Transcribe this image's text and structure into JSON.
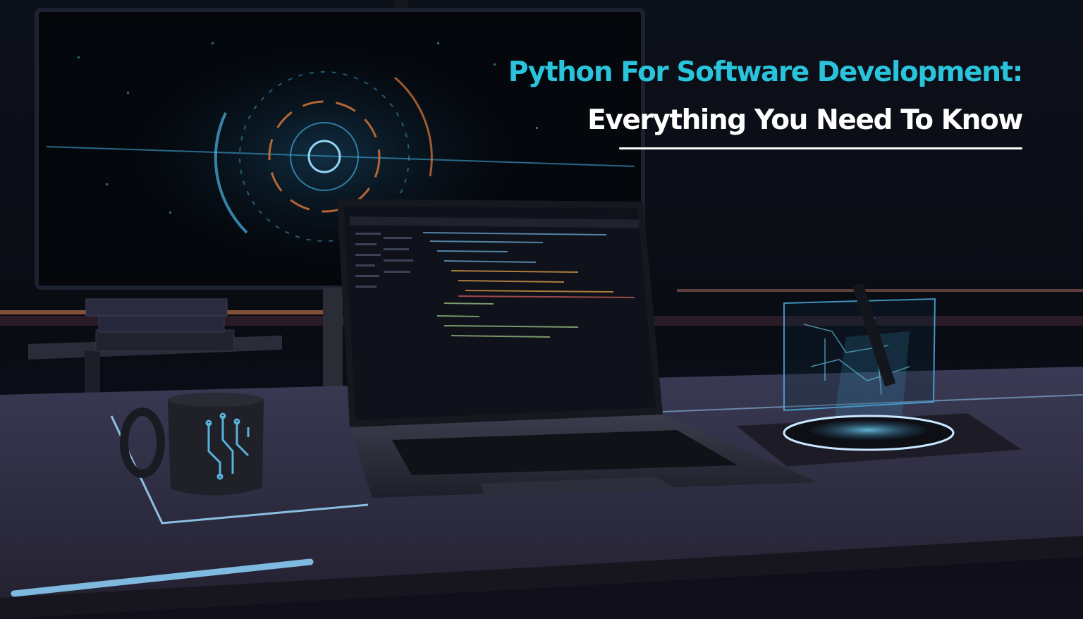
{
  "banner": {
    "title_line1": "Python For Software Development:",
    "title_line2": "Everything You Need To Know",
    "title_line1_color": "#29c4dc",
    "title_line2_color": "#ffffff"
  },
  "scene": {
    "description_icons": [
      "monitor-icon",
      "laptop-icon",
      "mug-icon",
      "books-icon",
      "hologram-icon",
      "charging-pad-icon"
    ],
    "accent_color": "#4fb3e6",
    "orange_accent_color": "#e07a3a"
  }
}
